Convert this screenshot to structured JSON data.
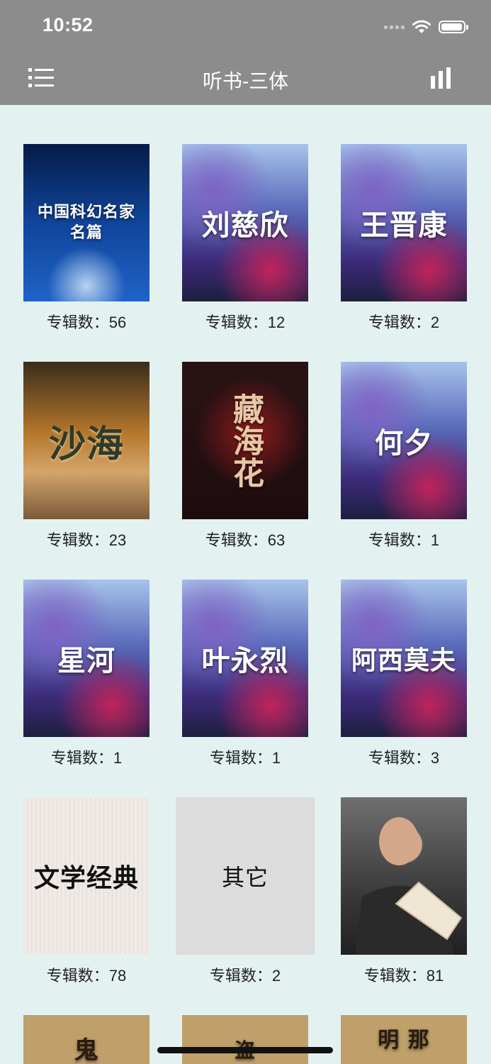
{
  "status_bar": {
    "time": "10:52"
  },
  "header": {
    "title": "听书-三体",
    "left_icon": "menu-icon",
    "right_icon": "bar-chart-icon"
  },
  "caption_prefix": "专辑数：",
  "grid": {
    "items": [
      {
        "cover_title": "中国科幻名家名篇",
        "caption": "专辑数：56"
      },
      {
        "cover_title": "刘慈欣",
        "caption": "专辑数：12"
      },
      {
        "cover_title": "王晋康",
        "caption": "专辑数：2"
      },
      {
        "cover_title": "沙海",
        "caption": "专辑数：23"
      },
      {
        "cover_title": "藏海花",
        "caption": "专辑数：63"
      },
      {
        "cover_title": "何夕",
        "caption": "专辑数：1"
      },
      {
        "cover_title": "星河",
        "caption": "专辑数：1"
      },
      {
        "cover_title": "叶永烈",
        "caption": "专辑数：1"
      },
      {
        "cover_title": "阿西莫夫",
        "caption": "专辑数：3"
      },
      {
        "cover_title": "文学经典",
        "caption": "专辑数：78"
      },
      {
        "cover_title": "其它",
        "caption": "专辑数：2"
      },
      {
        "cover_title": "",
        "caption": "专辑数：81"
      }
    ],
    "partial_row": [
      {
        "cover_title": "鬼"
      },
      {
        "cover_title": "盗"
      },
      {
        "cover_title": "明 那"
      }
    ]
  }
}
